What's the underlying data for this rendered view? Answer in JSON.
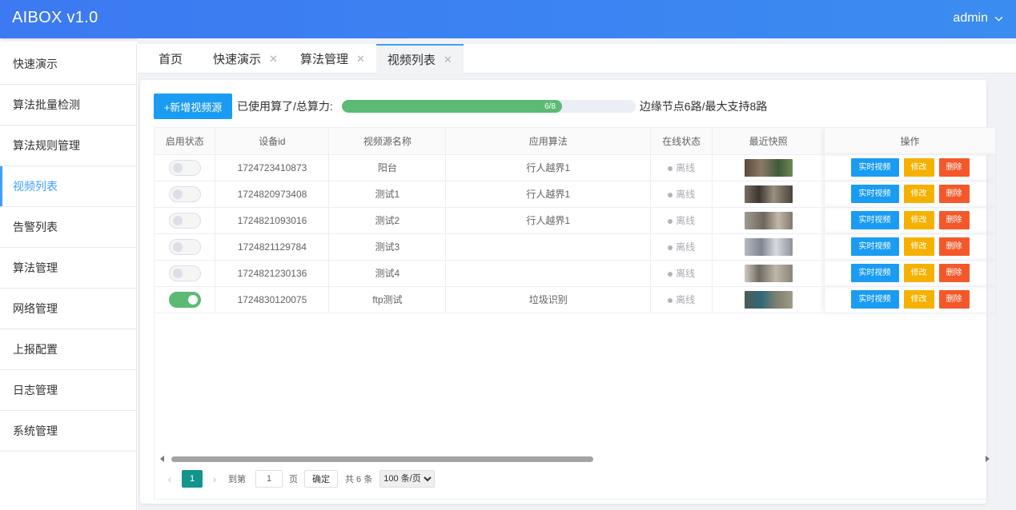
{
  "header": {
    "brand": "AIBOX v1.0",
    "user": "admin"
  },
  "sidebar": {
    "items": [
      {
        "label": "快速演示"
      },
      {
        "label": "算法批量检测"
      },
      {
        "label": "算法规则管理"
      },
      {
        "label": "视频列表"
      },
      {
        "label": "告警列表"
      },
      {
        "label": "算法管理"
      },
      {
        "label": "网络管理"
      },
      {
        "label": "上报配置"
      },
      {
        "label": "日志管理"
      },
      {
        "label": "系统管理"
      }
    ],
    "active": "视频列表"
  },
  "tabs": [
    {
      "label": "首页",
      "closable": false
    },
    {
      "label": "快速演示",
      "closable": true
    },
    {
      "label": "算法管理",
      "closable": true
    },
    {
      "label": "视频列表",
      "closable": true,
      "active": true
    }
  ],
  "toolbar": {
    "add_label": "+新增视频源",
    "quota_label": "已使用算了/总算力:",
    "progress_text": "6/8",
    "progress_fraction": 0.75,
    "quota_note": "边缘节点6路/最大支持8路"
  },
  "table": {
    "columns": [
      "启用状态",
      "设备id",
      "视频源名称",
      "应用算法",
      "在线状态",
      "最近快照",
      "操作"
    ],
    "rows": [
      {
        "enabled": false,
        "device_id": "1724723410873",
        "name": "阳台",
        "algorithm": "行人越界1",
        "status": "离线"
      },
      {
        "enabled": false,
        "device_id": "1724820973408",
        "name": "测试1",
        "algorithm": "行人越界1",
        "status": "离线"
      },
      {
        "enabled": false,
        "device_id": "1724821093016",
        "name": "测试2",
        "algorithm": "行人越界1",
        "status": "离线"
      },
      {
        "enabled": false,
        "device_id": "1724821129784",
        "name": "测试3",
        "algorithm": "",
        "status": "离线"
      },
      {
        "enabled": false,
        "device_id": "1724821230136",
        "name": "测试4",
        "algorithm": "",
        "status": "离线"
      },
      {
        "enabled": true,
        "device_id": "1724830120075",
        "name": "ftp测试",
        "algorithm": "垃圾识别",
        "status": "离线"
      }
    ],
    "actions": {
      "live": "实时视频",
      "edit": "修改",
      "delete": "删除"
    }
  },
  "pager": {
    "current": "1",
    "goto_label": "到第",
    "goto_value": "1",
    "page_suffix": "页",
    "confirm": "确定",
    "total": "共 6 条",
    "page_size": "100 条/页"
  },
  "colors": {
    "accent": "#409eff",
    "progress": "#5dba74",
    "live": "#1a9cf3",
    "edit": "#f5b100",
    "delete": "#f4582a"
  }
}
